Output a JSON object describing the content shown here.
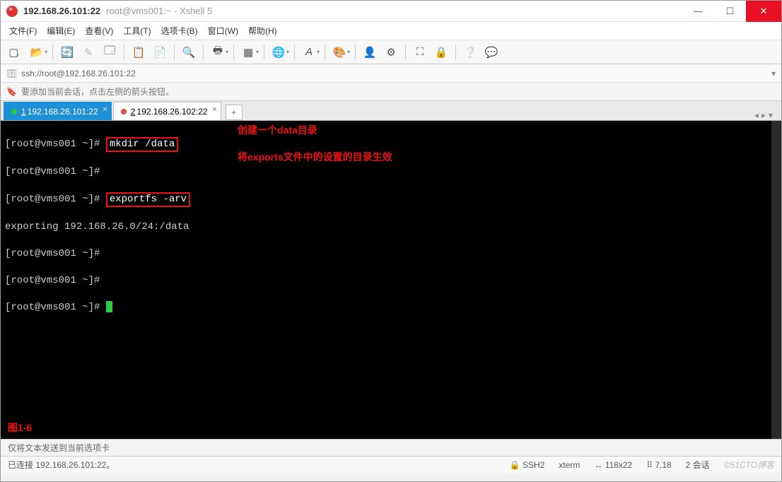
{
  "window": {
    "title_main": "192.168.26.101:22",
    "title_sub": "root@vms001:~ - Xshell 5"
  },
  "menu": {
    "file": "文件(F)",
    "edit": "编辑(E)",
    "view": "查看(V)",
    "tools": "工具(T)",
    "tabs": "选项卡(B)",
    "window": "窗口(W)",
    "help": "帮助(H)"
  },
  "address": {
    "url": "ssh://root@192.168.26.101:22"
  },
  "hint": {
    "text": "要添加当前会话，点击左侧的箭头按钮。"
  },
  "tabs": [
    {
      "index": "1",
      "label": "192.168.26.101:22",
      "active": true,
      "dot": "green"
    },
    {
      "index": "2",
      "label": "192.168.26.102:22",
      "active": false,
      "dot": "red"
    }
  ],
  "terminal": {
    "lines": [
      {
        "prompt": "[root@vms001 ~]# ",
        "cmd": "mkdir /data",
        "boxed": true
      },
      {
        "prompt": "[root@vms001 ~]#",
        "cmd": ""
      },
      {
        "prompt": "[root@vms001 ~]# ",
        "cmd": "exportfs -arv",
        "boxed": true
      },
      {
        "prompt": "",
        "cmd": "exporting 192.168.26.0/24:/data"
      },
      {
        "prompt": "[root@vms001 ~]#",
        "cmd": ""
      },
      {
        "prompt": "[root@vms001 ~]#",
        "cmd": ""
      },
      {
        "prompt": "[root@vms001 ~]# ",
        "cmd": "",
        "cursor": true
      }
    ],
    "note1": "创建一个data目录",
    "note2": "将exports文件中的设置的目录生效",
    "figure_label": "图1-6"
  },
  "status1": {
    "text": "仅将文本发送到当前选项卡"
  },
  "status2": {
    "connected": "已连接 192.168.26.101:22。",
    "proto": "SSH2",
    "termtype": "xterm",
    "size": "118x22",
    "pos": "7,18",
    "sessions": "2 会话",
    "watermark": "©51CTO博客"
  }
}
